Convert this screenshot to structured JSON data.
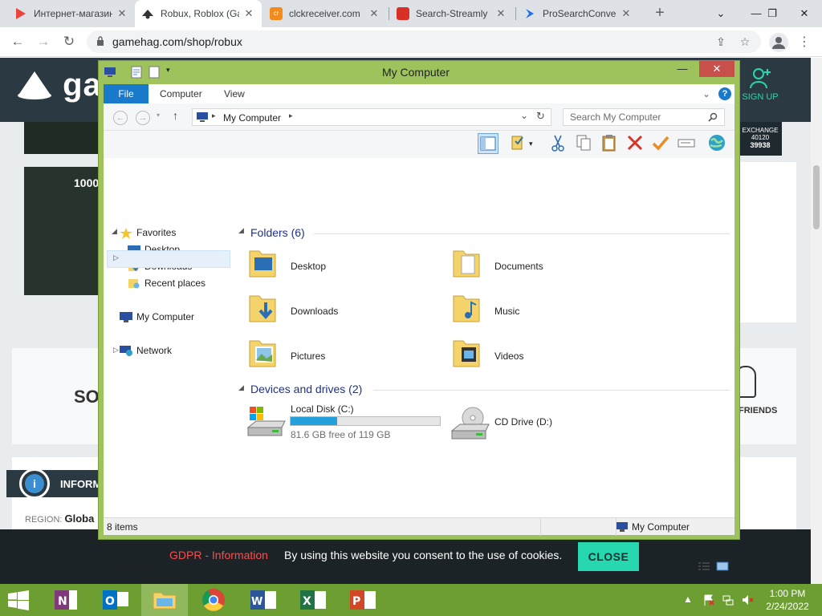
{
  "browser": {
    "tabs": [
      {
        "label": "Интернет-магазин",
        "favicon_color": "#e8453c"
      },
      {
        "label": "Robux, Roblox (Gamehag)",
        "favicon_color": "#333333"
      },
      {
        "label": "clckreceiver.com",
        "favicon_color": "#f28b1c"
      },
      {
        "label": "Search-Streamly",
        "favicon_color": "#d93025"
      },
      {
        "label": "ProSearchConverter",
        "favicon_color": "#1a73e8"
      }
    ],
    "new_tab": "+",
    "url": "gamehag.com/shop/robux"
  },
  "webpage": {
    "logo": "gam",
    "signup": "SIGN UP",
    "exchange": "EXCHANGE",
    "exchange_val1": "40120",
    "exchange_val2": "39938",
    "promo": "1000",
    "section_so": "SO",
    "friends": "FRIENDS",
    "info_heading": "INFORM",
    "region_label": "REGION:",
    "region_value": "Globa",
    "gdpr": "GDPR - Information",
    "cookie_msg": "By using this website you consent to the use of cookies.",
    "close": "CLOSE"
  },
  "explorer": {
    "title": "My Computer",
    "ribbon_tabs": [
      "File",
      "Computer",
      "View"
    ],
    "address": "My Computer",
    "search_placeholder": "Search My Computer",
    "nav": {
      "favorites": "Favorites",
      "favorites_items": [
        "Desktop",
        "Downloads",
        "Recent places"
      ],
      "my_computer": "My Computer",
      "network": "Network"
    },
    "folders_heading": "Folders (6)",
    "folders": [
      "Desktop",
      "Documents",
      "Downloads",
      "Music",
      "Pictures",
      "Videos"
    ],
    "devices_heading": "Devices and drives (2)",
    "drives": [
      {
        "name": "Local Disk (C:)",
        "free": "81.6 GB free of 119 GB",
        "used_fraction": 0.314
      },
      {
        "name": "CD Drive (D:)"
      }
    ],
    "item_count": "8 items",
    "status_count": "8 items",
    "status_location": "My Computer"
  },
  "taskbar": {
    "time": "1:00 PM",
    "date": "2/24/2022"
  },
  "colors": {
    "accent_green": "#9ec35c",
    "taskbar": "#6d9e32",
    "file_tab": "#1979ca",
    "close_btn": "#26d7b0"
  }
}
